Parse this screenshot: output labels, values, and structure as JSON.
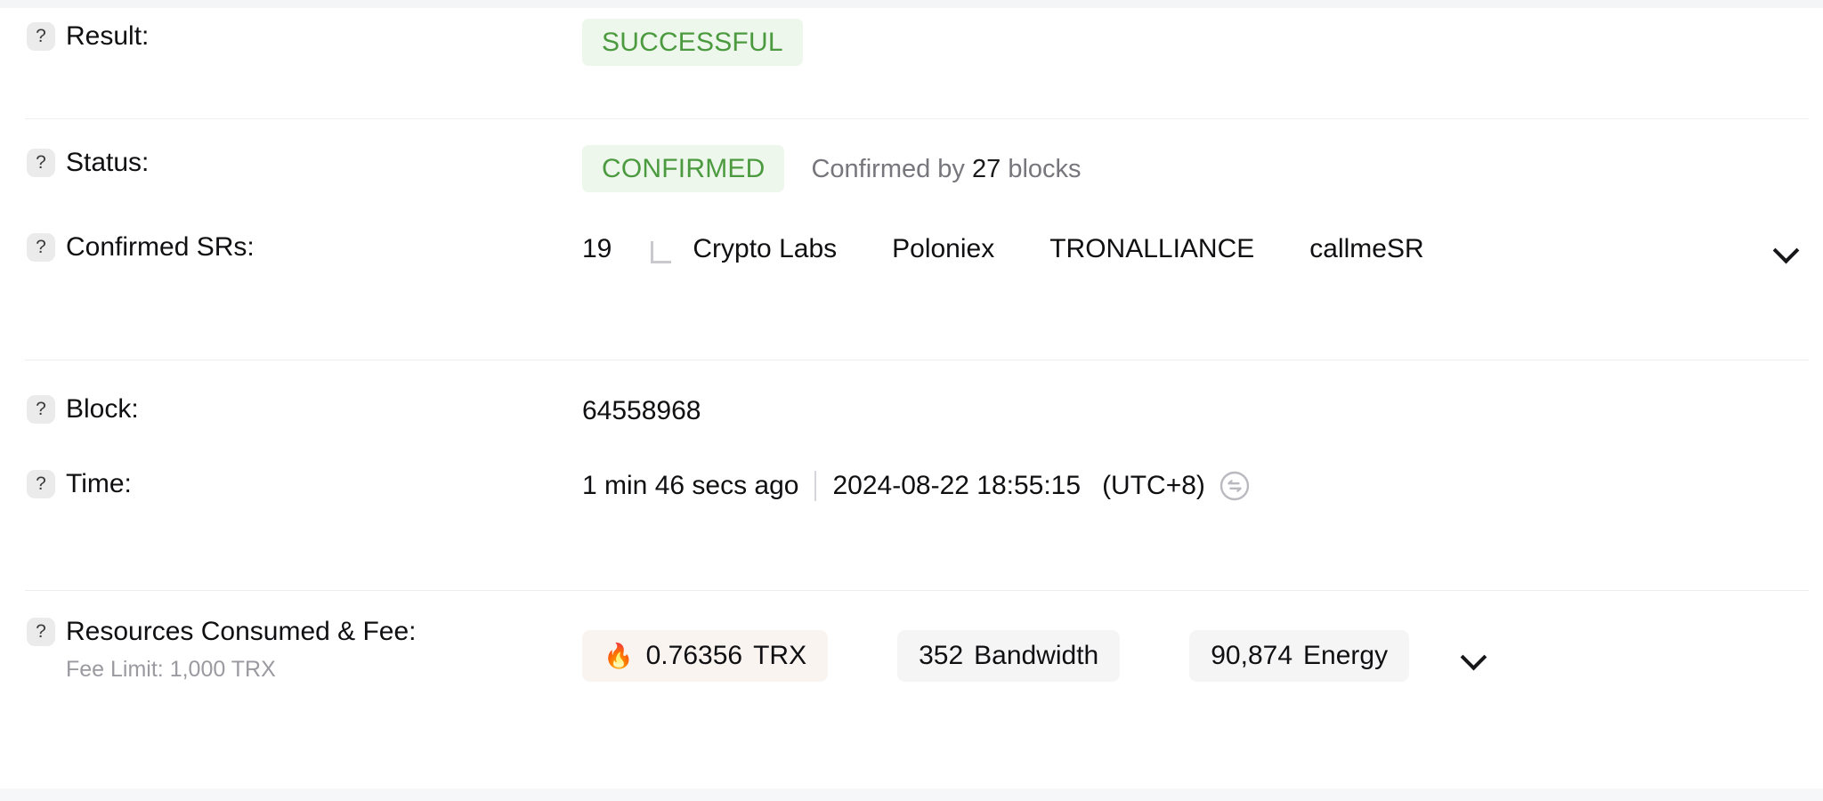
{
  "rows": {
    "result": {
      "label": "Result:",
      "help_icon": "question-mark-icon",
      "badge": "SUCCESSFUL"
    },
    "status": {
      "label": "Status:",
      "help_icon": "question-mark-icon",
      "badge": "CONFIRMED",
      "confirmed_by_prefix": "Confirmed by",
      "confirmed_by_count": "27",
      "confirmed_by_suffix": "blocks"
    },
    "confirmed_srs": {
      "label": "Confirmed SRs:",
      "help_icon": "question-mark-icon",
      "count": "19",
      "names": [
        "Crypto Labs",
        "Poloniex",
        "TRONALLIANCE",
        "callmeSR"
      ],
      "expand_icon": "chevron-down-icon"
    },
    "block": {
      "label": "Block:",
      "help_icon": "question-mark-icon",
      "value": "64558968"
    },
    "time": {
      "label": "Time:",
      "help_icon": "question-mark-icon",
      "relative": "1 min 46 secs ago",
      "separator": "|",
      "absolute": "2024-08-22 18:55:15",
      "timezone": "(UTC+8)",
      "swap_icon": "timezone-swap-icon"
    },
    "resources": {
      "label": "Resources Consumed & Fee:",
      "help_icon": "question-mark-icon",
      "fee_limit": "Fee Limit: 1,000 TRX",
      "chips": [
        {
          "icon": "flame-icon",
          "glyph": "🔥",
          "value": "0.76356",
          "unit": "TRX",
          "style": "fee"
        },
        {
          "icon": "",
          "glyph": "",
          "value": "352",
          "unit": "Bandwidth",
          "style": "neutral"
        },
        {
          "icon": "",
          "glyph": "",
          "value": "90,874",
          "unit": "Energy",
          "style": "neutral"
        }
      ],
      "expand_icon": "chevron-down-icon"
    }
  },
  "colors": {
    "success_text": "#4c9a3f",
    "success_bg": "#edf7ec",
    "fee_chip_bg": "#faf4f1",
    "neutral_chip_bg": "#f5f5f6",
    "text_primary": "#101012",
    "text_muted": "#76767c",
    "divider": "#eeeef0"
  }
}
